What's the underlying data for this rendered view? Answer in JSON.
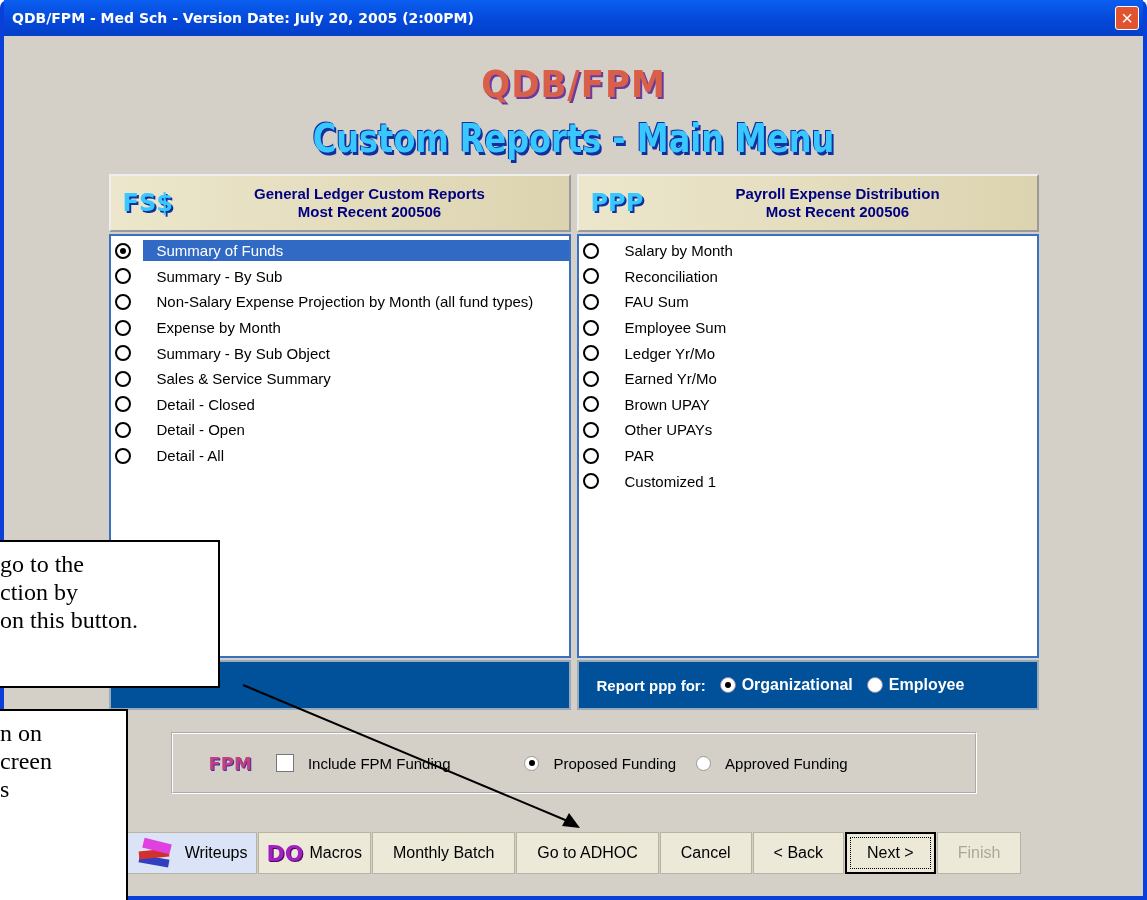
{
  "window": {
    "title": "QDB/FPM - Med Sch - Version Date: July 20, 2005 (2:00PM)",
    "close": "×"
  },
  "logo": {
    "title": "QDB/FPM",
    "subtitle": "Custom Reports - Main Menu"
  },
  "panels": [
    {
      "badge": "FS$",
      "title": "General Ledger Custom Reports",
      "subtitle": "Most Recent 200506",
      "items": [
        {
          "label": "Summary of Funds",
          "selected": true
        },
        {
          "label": "Summary - By Sub",
          "selected": false
        },
        {
          "label": "Non-Salary Expense Projection by Month (all fund types)",
          "selected": false
        },
        {
          "label": "Expense by Month",
          "selected": false
        },
        {
          "label": "Summary - By Sub Object",
          "selected": false
        },
        {
          "label": "Sales & Service Summary",
          "selected": false
        },
        {
          "label": "Detail - Closed",
          "selected": false
        },
        {
          "label": "Detail - Open",
          "selected": false
        },
        {
          "label": "Detail - All",
          "selected": false
        }
      ]
    },
    {
      "badge": "PPP",
      "title": "Payroll Expense Distribution",
      "subtitle": "Most Recent 200506",
      "items": [
        {
          "label": "Salary by Month",
          "selected": false
        },
        {
          "label": "Reconciliation",
          "selected": false
        },
        {
          "label": "FAU Sum",
          "selected": false
        },
        {
          "label": "Employee Sum",
          "selected": false
        },
        {
          "label": "Ledger Yr/Mo",
          "selected": false
        },
        {
          "label": "Earned Yr/Mo",
          "selected": false
        },
        {
          "label": "Brown UPAY",
          "selected": false
        },
        {
          "label": "Other UPAYs",
          "selected": false
        },
        {
          "label": "PAR",
          "selected": false
        },
        {
          "label": "Customized 1",
          "selected": false
        }
      ],
      "report_for": {
        "label": "Report  ppp for:",
        "options": [
          {
            "label": "Organizational",
            "selected": true
          },
          {
            "label": "Employee",
            "selected": false
          }
        ]
      }
    }
  ],
  "funding": {
    "badge": "FPM",
    "include": {
      "label": "Include FPM Funding",
      "checked": false
    },
    "options": [
      {
        "label": "Proposed Funding",
        "selected": true
      },
      {
        "label": "Approved Funding",
        "selected": false
      }
    ]
  },
  "buttons": [
    {
      "label": "Writeups",
      "kind": "books",
      "hovered": true,
      "default": false,
      "disabled": false
    },
    {
      "label": "Macros",
      "kind": "do",
      "icon_text": "DO",
      "hovered": false,
      "default": false,
      "disabled": false
    },
    {
      "label": "Monthly Batch",
      "hovered": false,
      "default": false,
      "disabled": false
    },
    {
      "label": "Go to ADHOC",
      "hovered": false,
      "default": false,
      "disabled": false
    },
    {
      "label": "Cancel",
      "hovered": false,
      "default": false,
      "disabled": false
    },
    {
      "label": "< Back",
      "hovered": false,
      "default": false,
      "disabled": false
    },
    {
      "label": "Next >",
      "hovered": false,
      "default": true,
      "disabled": false
    },
    {
      "label": "Finish",
      "hovered": false,
      "default": false,
      "disabled": true
    }
  ],
  "callouts": [
    {
      "text": "go to the\nction by\non this button."
    },
    {
      "text": "n on\ncreen\ns"
    }
  ]
}
